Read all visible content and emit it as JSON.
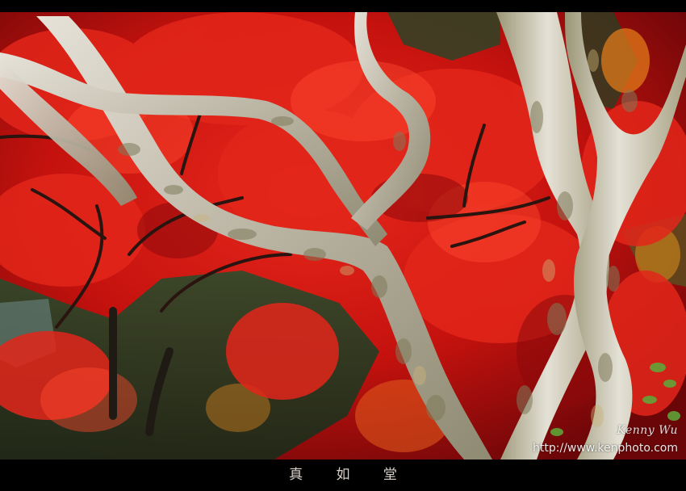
{
  "photo": {
    "description_icon": "maple-tree-photo",
    "signature": "Kenny Wu",
    "url": "http://www.kenphoto.com"
  },
  "caption": {
    "title": "真 如 堂"
  }
}
